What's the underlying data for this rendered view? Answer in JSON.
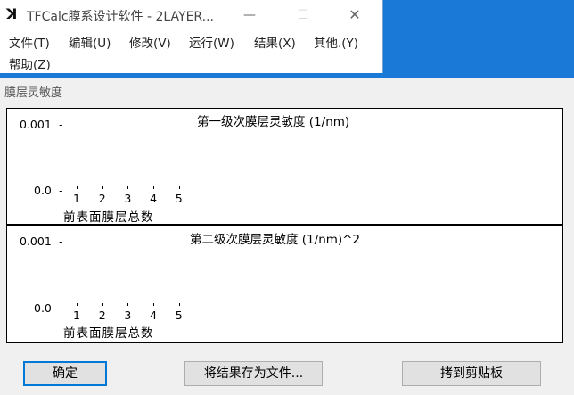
{
  "app": {
    "title": "TFCalc膜系设计软件 - 2LAYER...",
    "logo_glyph": "ꓘ",
    "controls": {
      "minimize": "—",
      "maximize": "☐",
      "close": "✕"
    },
    "menu": [
      "文件(T)",
      "编辑(U)",
      "修改(V)",
      "运行(W)",
      "结果(X)",
      "其他.(Y)",
      "帮助(Z)"
    ]
  },
  "dialog": {
    "title": "膜层灵敏度",
    "buttons": {
      "ok": "确定",
      "save": "将结果存为文件...",
      "copy": "拷到剪贴板"
    }
  },
  "chart_data": [
    {
      "type": "line",
      "title": "第一级次膜层灵敏度 (1/nm)",
      "xlabel": "前表面膜层总数",
      "x": [
        1,
        2,
        3,
        4,
        5
      ],
      "ytick_labels": [
        "0.001",
        "0.0"
      ],
      "ylim": [
        0,
        0.001
      ]
    },
    {
      "type": "line",
      "title": "第二级次膜层灵敏度 (1/nm)^2",
      "xlabel": "前表面膜层总数",
      "x": [
        1,
        2,
        3,
        4,
        5
      ],
      "ytick_labels": [
        "0.001",
        "0.0"
      ],
      "ylim": [
        0,
        0.001
      ]
    }
  ]
}
